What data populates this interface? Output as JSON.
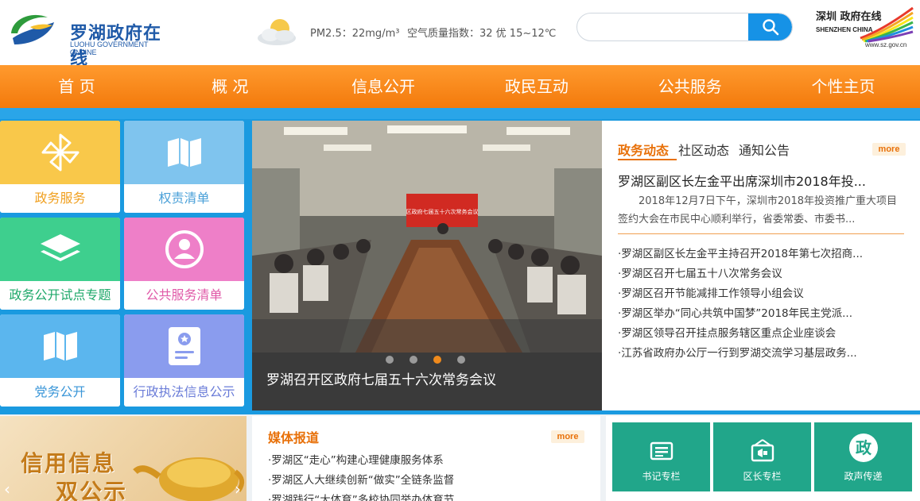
{
  "header": {
    "logo_cn": "罗湖政府在线",
    "logo_en": "LUOHU GOVERNMENT ONLINE",
    "pm25": "PM2.5：22mg/m³",
    "aqi": "空气质量指数：32 优   15~12℃",
    "search_placeholder": "",
    "sz_logo_cn": "深圳 政府在线",
    "sz_logo_en": "SHENZHEN CHINA",
    "sz_url": "www.sz.gov.cn"
  },
  "nav": [
    "首 页",
    "概 况",
    "信息公开",
    "政民互动",
    "公共服务",
    "个性主页"
  ],
  "tiles": [
    {
      "label": "政务服务",
      "icon": "pinwheel-icon",
      "color": "#f9c84a",
      "text_color": "#f0a020"
    },
    {
      "label": "权责清单",
      "icon": "book-icon",
      "color": "#7fc4ee",
      "text_color": "#4aa0d8"
    },
    {
      "label": "政务公开试点专题",
      "icon": "layers-icon",
      "color": "#3ecf8e",
      "text_color": "#1ea86a"
    },
    {
      "label": "公共服务清单",
      "icon": "user-circle-icon",
      "color": "#ee7fc8",
      "text_color": "#e05aa8"
    },
    {
      "label": "党务公开",
      "icon": "book-icon",
      "color": "#5bb6ee",
      "text_color": "#3a96d8"
    },
    {
      "label": "行政执法信息公示",
      "icon": "certificate-icon",
      "color": "#8a9cee",
      "text_color": "#6a7cd8"
    }
  ],
  "slideshow": {
    "caption": "罗湖召开区政府七届五十六次常务会议",
    "banner": "区政府七届五十六次常务会议",
    "active_index": 2,
    "count": 4
  },
  "news": {
    "tabs": [
      "政务动态",
      "社区动态",
      "通知公告"
    ],
    "active_tab": 0,
    "more": "more",
    "headline": "罗湖区副区长左金平出席深圳市2018年投...",
    "summary": "2018年12月7日下午，深圳市2018年投资推广重大项目签约大会在市民中心顺利举行，省委常委、市委书...",
    "items": [
      "·罗湖区副区长左金平主持召开2018年第七次招商...",
      "·罗湖区召开七届五十八次常务会议",
      "·罗湖区召开节能减排工作领导小组会议",
      "·罗湖区举办“同心共筑中国梦”2018年民主党派...",
      "·罗湖区领导召开挂点服务辖区重点企业座谈会",
      "·江苏省政府办公厅一行到罗湖交流学习基层政务..."
    ]
  },
  "credit": {
    "line1": "信用信息",
    "line2": "双公示"
  },
  "media": {
    "title": "媒体报道",
    "more": "more",
    "items": [
      "·罗湖区“走心”构建心理健康服务体系",
      "·罗湖区人大继续创新“做实”全链条监督",
      "·罗湖践行“大体育”多校协同举办体育节"
    ]
  },
  "columns": [
    {
      "label": "书记专栏",
      "icon": "notice-board-icon"
    },
    {
      "label": "区长专栏",
      "icon": "megaphone-board-icon"
    },
    {
      "label": "政声传递",
      "icon": "zheng-badge-icon",
      "badge": "政"
    }
  ]
}
